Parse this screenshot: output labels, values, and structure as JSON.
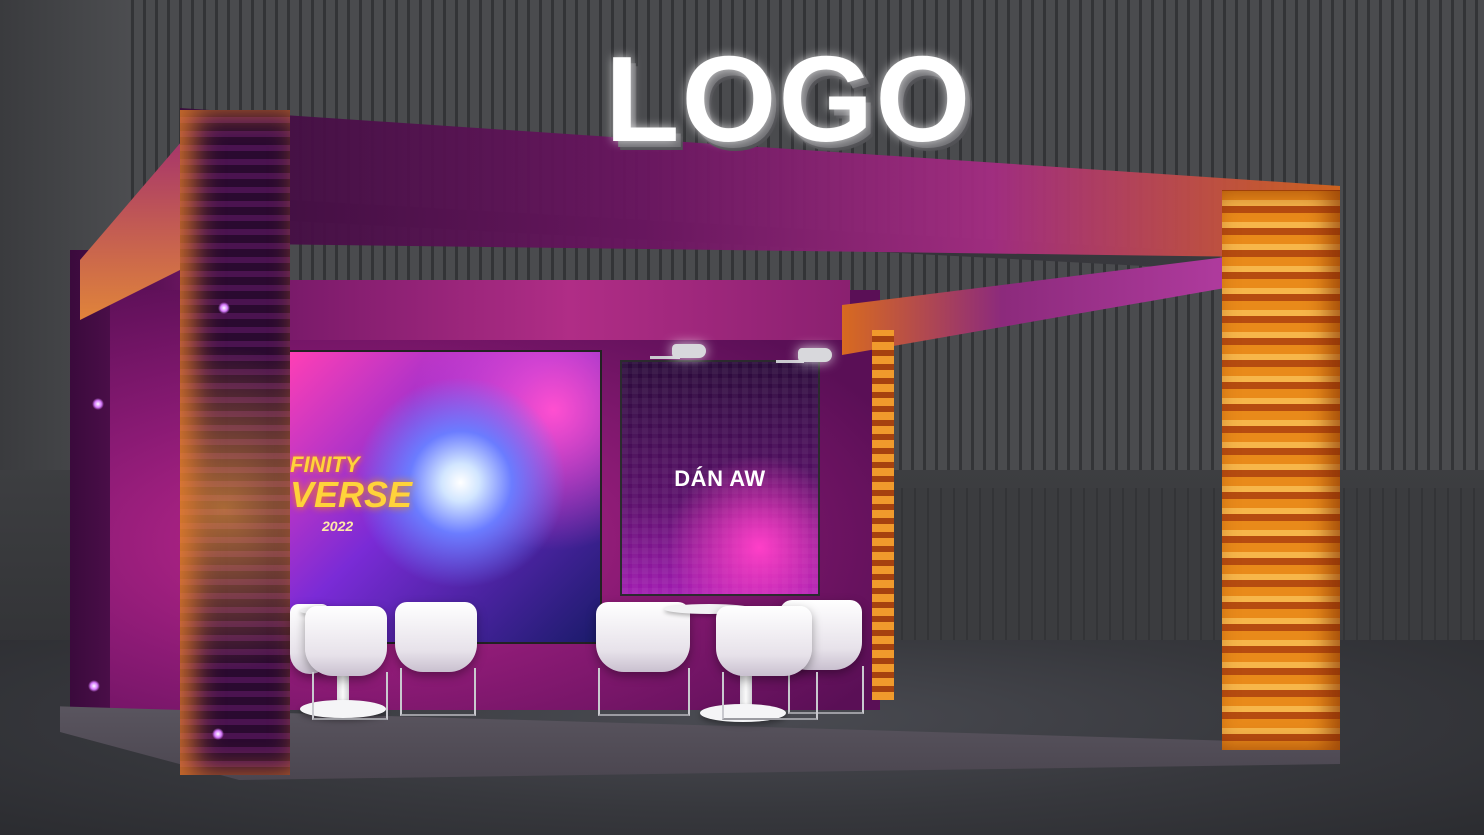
{
  "scene": {
    "description_tags": [
      "exhibition-booth",
      "render"
    ],
    "logo_text": "LOGO",
    "screen": {
      "title_line1": "FINITY",
      "title_line2": "VERSE",
      "year": "2022"
    },
    "artwork_panel": {
      "label": "DÁN AW"
    },
    "colors": {
      "booth_purple": "#8a1a74",
      "led_orange": "#e98a1a",
      "wall_gray": "#4a4b4e",
      "logo_white": "#ffffff"
    }
  }
}
